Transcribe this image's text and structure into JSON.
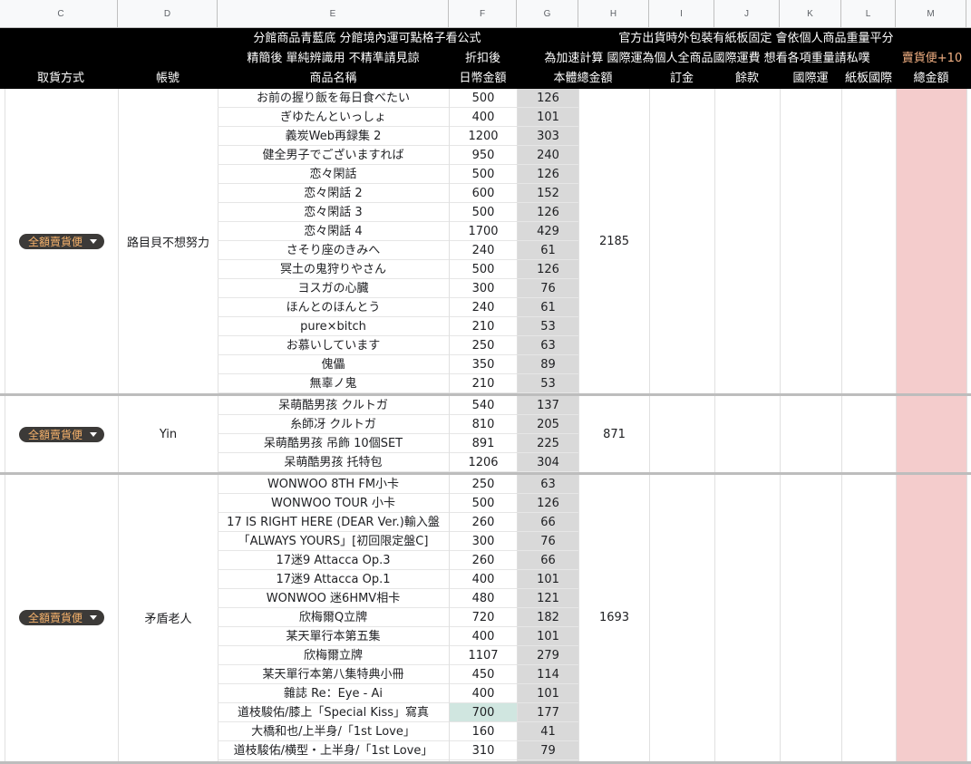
{
  "column_letters": [
    "C",
    "D",
    "E",
    "F",
    "G",
    "H",
    "I",
    "J",
    "K",
    "L",
    "M"
  ],
  "header": {
    "line1_left": "分館商品青藍底 分館境內運可點格子看公式",
    "line1_right": "官方出貨時外包裝有紙板固定 會依個人商品重量平分",
    "line2_e": "精簡後 單純辨識用 不精準請見諒",
    "line2_f": "折扣後",
    "line2_right": "為加速計算 國際運為個人全商品國際運費 想看各項重量請私噗",
    "line2_m": "賣貨便+10",
    "col_c": "取貨方式",
    "col_d": "帳號",
    "col_e": "商品名稱",
    "col_f": "日幣金額",
    "col_g": "本體總金額",
    "col_i": "訂金",
    "col_j": "餘款",
    "col_k": "國際運",
    "col_l": "紙板國際",
    "col_m": "總金額"
  },
  "groups": [
    {
      "delivery": "全額賣貨便",
      "account": "路目貝不想努力",
      "total": "2185",
      "items": [
        {
          "name": "お前の握り飯を毎日食べたい",
          "jpy": "500",
          "twd": "126"
        },
        {
          "name": "ぎゆたんといっしょ",
          "jpy": "400",
          "twd": "101"
        },
        {
          "name": "義炭Web再録集 2",
          "jpy": "1200",
          "twd": "303"
        },
        {
          "name": "健全男子でございますれば",
          "jpy": "950",
          "twd": "240"
        },
        {
          "name": "恋々閑話",
          "jpy": "500",
          "twd": "126"
        },
        {
          "name": "恋々閑話 2",
          "jpy": "600",
          "twd": "152"
        },
        {
          "name": "恋々閑話 3",
          "jpy": "500",
          "twd": "126"
        },
        {
          "name": "恋々閑話 4",
          "jpy": "1700",
          "twd": "429"
        },
        {
          "name": "さそり座のきみへ",
          "jpy": "240",
          "twd": "61"
        },
        {
          "name": "冥土の鬼狩りやさん",
          "jpy": "500",
          "twd": "126"
        },
        {
          "name": "ヨスガの心臓",
          "jpy": "300",
          "twd": "76"
        },
        {
          "name": "ほんとのほんとう",
          "jpy": "240",
          "twd": "61"
        },
        {
          "name": "pure×bitch",
          "jpy": "210",
          "twd": "53"
        },
        {
          "name": "お慕いしています",
          "jpy": "250",
          "twd": "63"
        },
        {
          "name": "傀儡",
          "jpy": "350",
          "twd": "89"
        },
        {
          "name": "無辜ノ鬼",
          "jpy": "210",
          "twd": "53"
        }
      ]
    },
    {
      "delivery": "全額賣貨便",
      "account": "Yin",
      "total": "871",
      "items": [
        {
          "name": "呆萌酷男孩 クルトガ",
          "jpy": "540",
          "twd": "137"
        },
        {
          "name": "糸師冴 クルトガ",
          "jpy": "810",
          "twd": "205"
        },
        {
          "name": "呆萌酷男孩 吊飾 10個SET",
          "jpy": "891",
          "twd": "225"
        },
        {
          "name": "呆萌酷男孩 托特包",
          "jpy": "1206",
          "twd": "304"
        }
      ]
    },
    {
      "delivery": "全額賣貨便",
      "account": "矛盾老人",
      "total": "1693",
      "items": [
        {
          "name": "WONWOO 8TH FM小卡",
          "jpy": "250",
          "twd": "63"
        },
        {
          "name": "WONWOO TOUR 小卡",
          "jpy": "500",
          "twd": "126"
        },
        {
          "name": "17 IS RIGHT HERE (DEAR Ver.)輸入盤",
          "jpy": "260",
          "twd": "66"
        },
        {
          "name": "「ALWAYS YOURS」[初回限定盤C]",
          "jpy": "300",
          "twd": "76"
        },
        {
          "name": "17迷9 Attacca Op.3",
          "jpy": "260",
          "twd": "66"
        },
        {
          "name": "17迷9 Attacca Op.1",
          "jpy": "400",
          "twd": "101"
        },
        {
          "name": "WONWOO 迷6HMV相卡",
          "jpy": "480",
          "twd": "121"
        },
        {
          "name": "欣梅爾Q立牌",
          "jpy": "720",
          "twd": "182"
        },
        {
          "name": "某天單行本第五集",
          "jpy": "400",
          "twd": "101"
        },
        {
          "name": "欣梅爾立牌",
          "jpy": "1107",
          "twd": "279"
        },
        {
          "name": "某天單行本第八集特典小冊",
          "jpy": "450",
          "twd": "114"
        },
        {
          "name": "雜誌 Re：Eye - Ai",
          "jpy": "400",
          "twd": "101"
        },
        {
          "name": "道枝駿佑/膝上「Special Kiss」寫真",
          "jpy": "700",
          "twd": "177",
          "highlight": true
        },
        {
          "name": "大橋和也/上半身/「1st Love」",
          "jpy": "160",
          "twd": "41"
        },
        {
          "name": "道枝駿佑/横型・上半身/「1st Love」",
          "jpy": "310",
          "twd": "79"
        }
      ]
    }
  ],
  "colors": {
    "header_bg": "#000000",
    "accent_orange": "#f4b183",
    "gray_column": "#d9d9d9",
    "pink_column": "#f4cccc",
    "chip_bg": "#3c3a38",
    "highlight_cell": "#d0e6e0"
  }
}
